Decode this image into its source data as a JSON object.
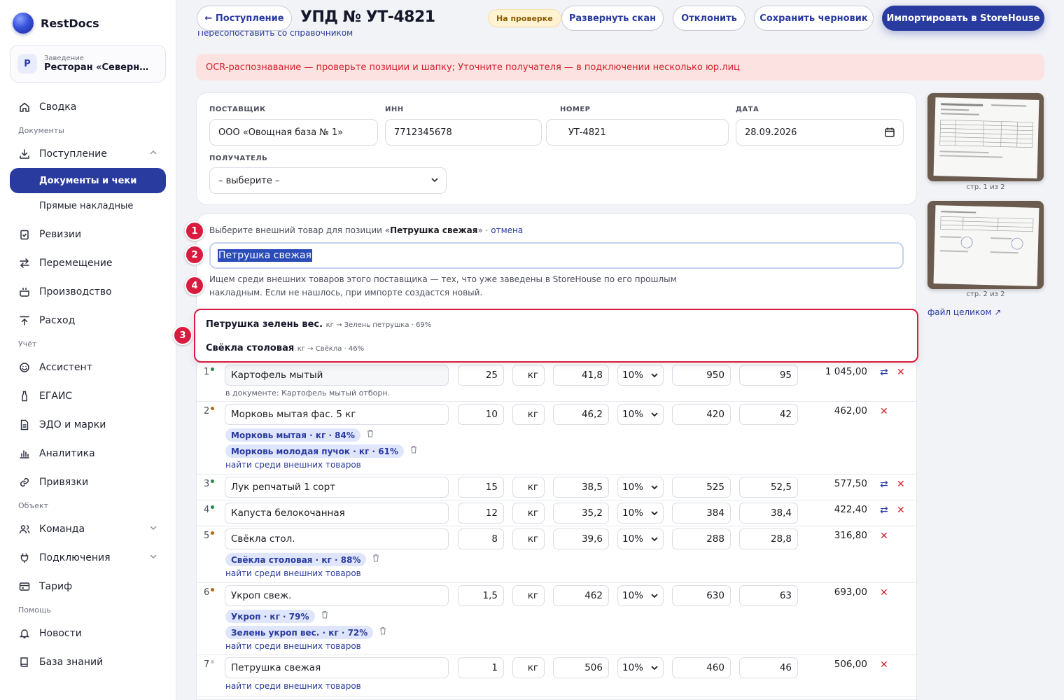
{
  "app": {
    "name": "RestDocs"
  },
  "venue": {
    "caption": "Заведение",
    "name": "Ресторан «Северный …",
    "initial": "Р"
  },
  "nav": {
    "summary": "Сводка",
    "section_docs": "Документы",
    "incoming": "Поступление",
    "sub_docs": "Документы и чеки",
    "sub_direct": "Прямые накладные",
    "revisions": "Ревизии",
    "transfer": "Перемещение",
    "production": "Производство",
    "expense": "Расход",
    "section_account": "Учёт",
    "assistant": "Ассистент",
    "egais": "ЕГАИС",
    "edo": "ЭДО и марки",
    "analytics": "Аналитика",
    "bindings": "Привязки",
    "section_object": "Объект",
    "team": "Команда",
    "connections": "Подключения",
    "tariff": "Тариф",
    "section_help": "Помощь",
    "news": "Новости",
    "kb": "База знаний"
  },
  "header": {
    "back_label": "← Поступление",
    "title": "УПД № УТ-4821",
    "status": "На проверке",
    "expand_scan": "Развернуть скан",
    "reject": "Отклонить",
    "save_draft": "Сохранить черновик",
    "import": "Импортировать в StoreHouse",
    "cut_text": "Пересопоставить со справочником"
  },
  "alert": "OCR-распознавание — проверьте позиции и шапку; Уточните получателя — в подключении несколько юр.лиц",
  "doc_fields": {
    "supplier_label": "ПОСТАВЩИК",
    "supplier": "ООО «Овощная база № 1»",
    "inn_label": "ИНН",
    "inn": "7712345678",
    "number_label": "НОМЕР",
    "number": "УТ-4821",
    "date_label": "ДАТА",
    "date": "28.09.2026",
    "recipient_label": "ПОЛУЧАТЕЛЬ",
    "recipient": "– выберите –"
  },
  "matching": {
    "prompt_prefix": "Выберите внешний товар для позиции «",
    "prompt_item": "Петрушка свежая",
    "prompt_suffix": "» · ",
    "cancel": "отмена",
    "search_value": "Петрушка свежая",
    "help": "Ищем среди внешних товаров этого поставщика — тех, что уже заведены в StoreHouse по его прошлым накладным. Если не нашлось, при импорте создастся новый.",
    "steps": [
      "1",
      "2",
      "3",
      "4"
    ],
    "suggestions": [
      {
        "name": "Петрушка зелень вес.",
        "meta": "кг → Зелень петрушка · 69%"
      },
      {
        "name": "Свёкла столовая",
        "meta": "кг → Свёкла · 46%"
      }
    ]
  },
  "rows": [
    {
      "num": "1",
      "dot": "#1f8a4c",
      "name": "Картофель мытый",
      "qty": "25",
      "unit": "кг",
      "price": "41,8",
      "vat": "10%",
      "sum": "950",
      "vat_sum": "95",
      "total": "1 045,00",
      "note": "в документе: Картофель мытый отборн.",
      "chips": [],
      "find": "",
      "swap": true
    },
    {
      "num": "2",
      "dot": "#b5651d",
      "name": "Морковь мытая фас. 5 кг",
      "qty": "10",
      "unit": "кг",
      "price": "46,2",
      "vat": "10%",
      "sum": "420",
      "vat_sum": "42",
      "total": "462,00",
      "note": "",
      "chips": [
        "Морковь мытая · кг · 84%",
        "Морковь молодая пучок · кг · 61%"
      ],
      "find": "найти среди внешних товаров",
      "swap": false
    },
    {
      "num": "3",
      "dot": "#1f8a4c",
      "name": "Лук репчатый 1 сорт",
      "qty": "15",
      "unit": "кг",
      "price": "38,5",
      "vat": "10%",
      "sum": "525",
      "vat_sum": "52,5",
      "total": "577,50",
      "note": "",
      "chips": [],
      "find": "",
      "swap": true
    },
    {
      "num": "4",
      "dot": "#1f8a4c",
      "name": "Капуста белокочанная",
      "qty": "12",
      "unit": "кг",
      "price": "35,2",
      "vat": "10%",
      "sum": "384",
      "vat_sum": "38,4",
      "total": "422,40",
      "note": "",
      "chips": [],
      "find": "",
      "swap": true
    },
    {
      "num": "5",
      "dot": "#b5651d",
      "name": "Свёкла стол.",
      "qty": "8",
      "unit": "кг",
      "price": "39,6",
      "vat": "10%",
      "sum": "288",
      "vat_sum": "28,8",
      "total": "316,80",
      "note": "",
      "chips": [
        "Свёкла столовая · кг · 88%"
      ],
      "find": "найти среди внешних товаров",
      "swap": false
    },
    {
      "num": "6",
      "dot": "#b5651d",
      "name": "Укроп свеж.",
      "qty": "1,5",
      "unit": "кг",
      "price": "462",
      "vat": "10%",
      "sum": "630",
      "vat_sum": "63",
      "total": "693,00",
      "note": "",
      "chips": [
        "Укроп · кг · 79%",
        "Зелень укроп вес. · кг · 72%"
      ],
      "find": "найти среди внешних товаров",
      "swap": false
    },
    {
      "num": "7",
      "dot": "#c3c6ce",
      "name": "Петрушка свежая",
      "qty": "1",
      "unit": "кг",
      "price": "506",
      "vat": "10%",
      "sum": "460",
      "vat_sum": "46",
      "total": "506,00",
      "note": "",
      "chips": [],
      "find": "найти среди внешних товаров",
      "swap": false
    }
  ],
  "scans": {
    "page1": "стр. 1 из 2",
    "page2": "стр. 2 из 2",
    "file_link": "файл целиком ↗"
  },
  "icons": {
    "swap": "⇄",
    "delete": "✕",
    "trash": "🗑"
  }
}
